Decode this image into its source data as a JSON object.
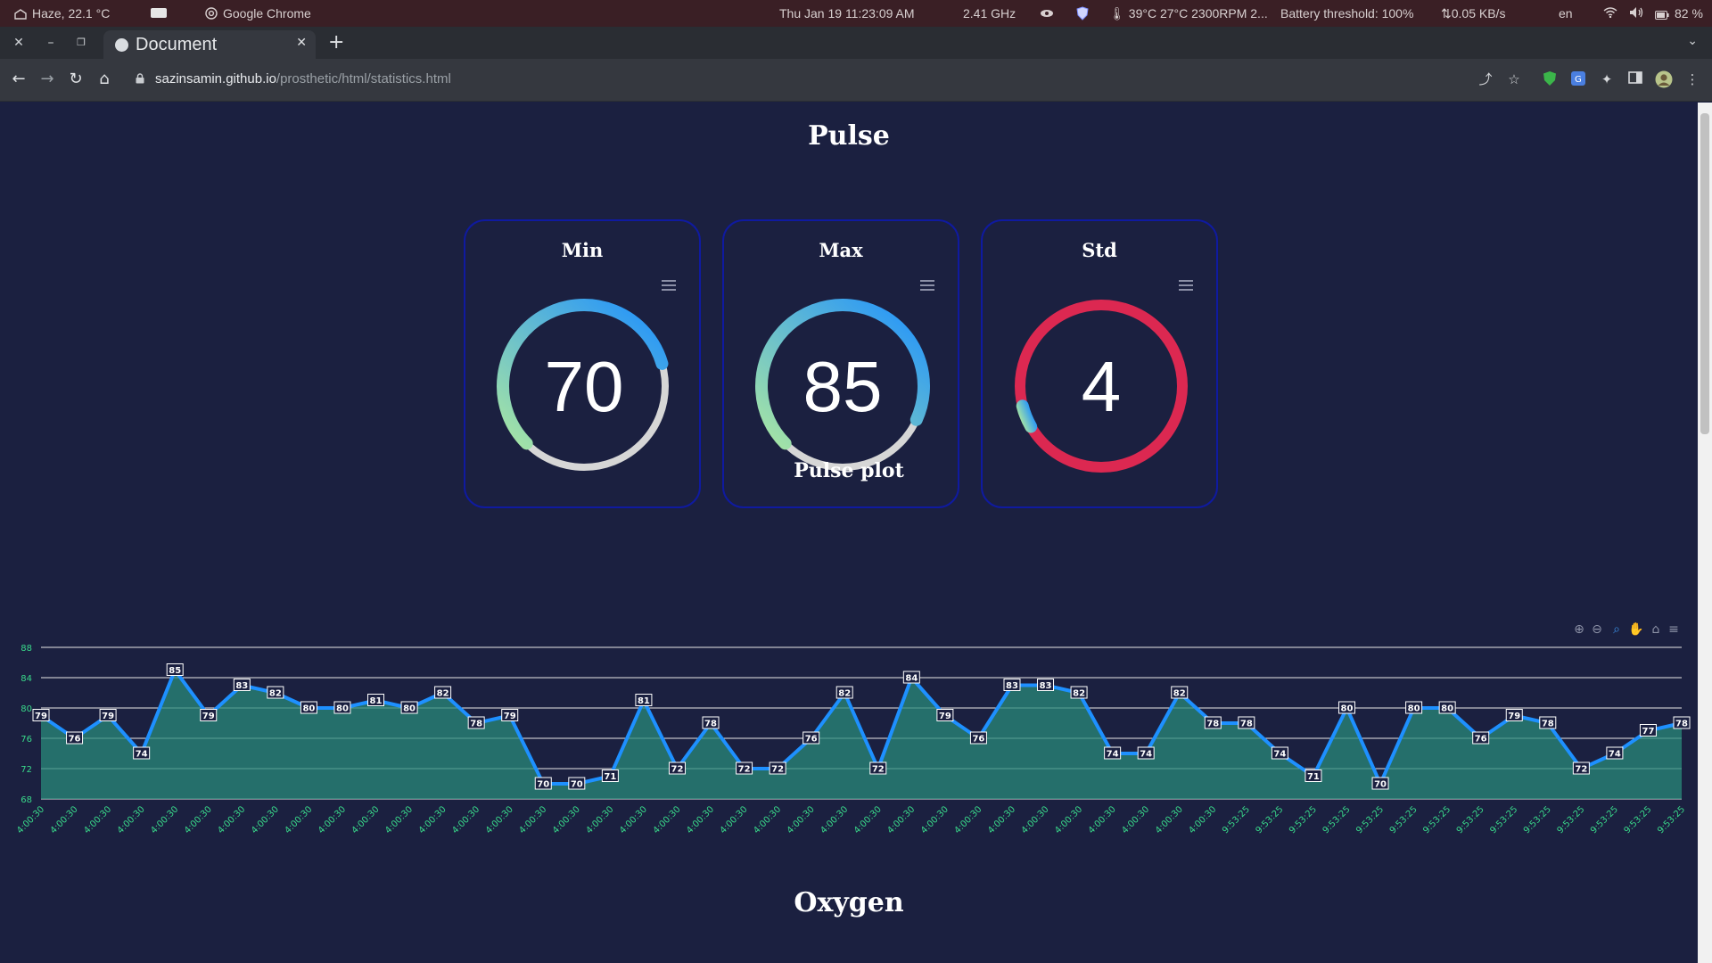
{
  "system_bar": {
    "weather": "Haze, 22.1 °C",
    "app": "Google Chrome",
    "clock": "Thu Jan 19  11:23:09 AM",
    "cpu_freq": "2.41 GHz",
    "sensors": "39°C 27°C 2300RPM 2...",
    "battery_threshold": "Battery threshold: 100%",
    "net_speed": "0.05 KB/s",
    "language": "en",
    "battery": "82 %"
  },
  "browser": {
    "tab_title": "Document",
    "url_host": "sazinsamin.github.io",
    "url_path": "/prosthetic/html/statistics.html"
  },
  "page": {
    "section_title": "Pulse",
    "next_section_title": "Oxygen",
    "plot_title": "Pulse plot"
  },
  "gauges": [
    {
      "label": "Min",
      "value": "70",
      "fill": 0.7,
      "style": "gradient"
    },
    {
      "label": "Max",
      "value": "85",
      "fill": 0.85,
      "style": "gradient"
    },
    {
      "label": "Std",
      "value": "4",
      "fill": 0.04,
      "style": "red"
    }
  ],
  "colors": {
    "background": "#1b2040",
    "card_border": "#0f1aa0",
    "line": "#1e90ff",
    "area": "#2a8a7a",
    "tick_labels": "#39d98a",
    "gauge_green": "#a8e6a3",
    "gauge_blue": "#1e90ff",
    "gauge_red": "#dc2851"
  },
  "chart_data": {
    "type": "area",
    "ylim": [
      68,
      88
    ],
    "yticks": [
      68,
      72,
      76,
      80,
      84,
      88
    ],
    "x": [
      "4:00:30",
      "4:00:30",
      "4:00:30",
      "4:00:30",
      "4:00:30",
      "4:00:30",
      "4:00:30",
      "4:00:30",
      "4:00:30",
      "4:00:30",
      "4:00:30",
      "4:00:30",
      "4:00:30",
      "4:00:30",
      "4:00:30",
      "4:00:30",
      "4:00:30",
      "4:00:30",
      "4:00:30",
      "4:00:30",
      "4:00:30",
      "4:00:30",
      "4:00:30",
      "4:00:30",
      "4:00:30",
      "4:00:30",
      "4:00:30",
      "4:00:30",
      "4:00:30",
      "4:00:30",
      "4:00:30",
      "4:00:30",
      "4:00:30",
      "4:00:30",
      "4:00:30",
      "4:00:30",
      "9:53:25",
      "9:53:25",
      "9:53:25",
      "9:53:25",
      "9:53:25",
      "9:53:25",
      "9:53:25",
      "9:53:25",
      "9:53:25",
      "9:53:25",
      "9:53:25",
      "9:53:25",
      "9:53:25",
      "9:53:25"
    ],
    "values": [
      79,
      76,
      79,
      74,
      85,
      79,
      83,
      82,
      80,
      80,
      81,
      80,
      82,
      78,
      79,
      70,
      70,
      71,
      81,
      72,
      78,
      72,
      72,
      76,
      82,
      72,
      84,
      79,
      76,
      83,
      83,
      82,
      74,
      74,
      82,
      78,
      78,
      74,
      71,
      80,
      70,
      80,
      80,
      76,
      79,
      78,
      72,
      74,
      77,
      78
    ],
    "grid": true,
    "data_labels": true
  }
}
